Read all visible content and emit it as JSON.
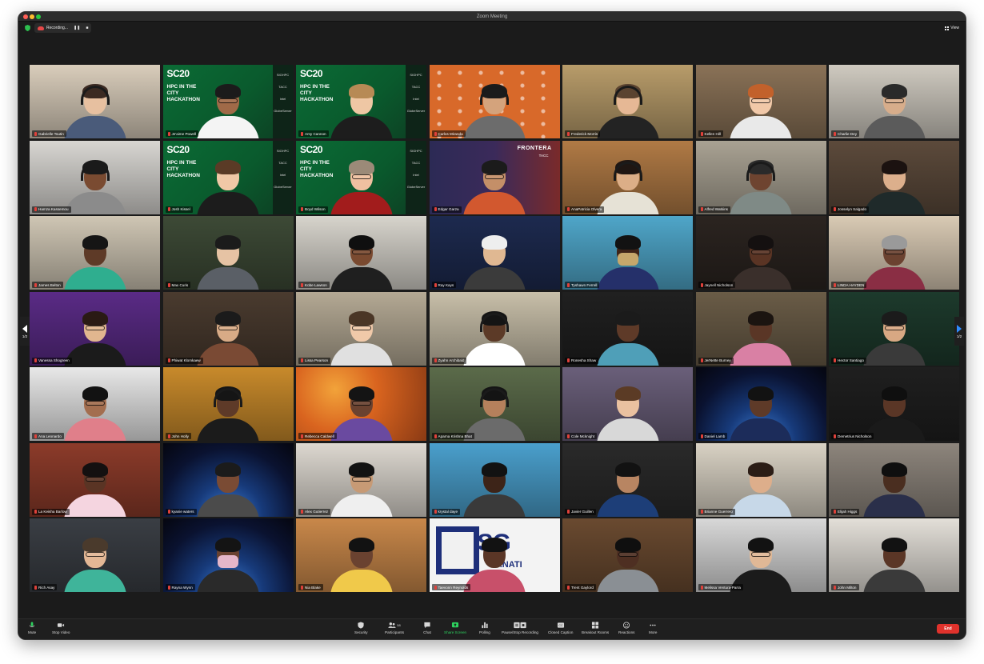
{
  "window": {
    "title": "Zoom Meeting"
  },
  "topbar": {
    "recording_label": "Recording...",
    "view_label": "View"
  },
  "pagination": {
    "left": "1/2",
    "right": "1/2"
  },
  "sc20": {
    "logo": "SC20",
    "title": "HPC IN THE CITY HACKATHON",
    "sponsors": [
      "SIGHPC",
      "TACC",
      "Intel",
      "GlobeServer"
    ]
  },
  "frontera": {
    "title": "FRONTERA",
    "tacc": "TACC"
  },
  "sgc": {
    "main": "SG",
    "sub": "ERNATI"
  },
  "participants": [
    {
      "name": "Gabrielle Toutin",
      "bg": "#d9cdbb",
      "skin": "#e7c0a0",
      "hair": "#3b2a22",
      "shirt": "#4a5b7a",
      "phones": true
    },
    {
      "name": "Je'aime Powell",
      "bg": "sc20",
      "skin": "#a06a48",
      "hair": "#1b1b1b",
      "shirt": "#f4f4f4",
      "glasses": true
    },
    {
      "name": "Amy Cannon",
      "bg": "sc20",
      "skin": "#efc7a4",
      "hair": "#b78a55",
      "shirt": "#1d1d1d"
    },
    {
      "name": "Carlos Miranda",
      "bg": "texas",
      "skin": "#d4a37c",
      "hair": "#1b1b1b",
      "shirt": "#6c6c6c",
      "phones": true
    },
    {
      "name": "Frederick Morris",
      "bg": "#b89c6a",
      "skin": "#e6b895",
      "hair": "#5a4330",
      "shirt": "#232323",
      "phones": true
    },
    {
      "name": "Kellen Hill",
      "bg": "#8a7257",
      "skin": "#f1c8a8",
      "hair": "#c2612b",
      "shirt": "#e9e9e9",
      "glasses": true
    },
    {
      "name": "Charlie Dey",
      "bg": "#cfcac0",
      "skin": "#d7ad8b",
      "hair": "#2a2a2a",
      "shirt": "#5b5b5b",
      "glasses": true
    },
    {
      "name": "Hamza Kassemou",
      "bg": "#d8d6d2",
      "skin": "#7a4b31",
      "hair": "#1a1a1a",
      "shirt": "#8b8b8b",
      "phones": true
    },
    {
      "name": "Josh Kissel",
      "bg": "sc20",
      "skin": "#f0c8a6",
      "hair": "#5a3b26",
      "shirt": "#1c1c1c"
    },
    {
      "name": "Boyd Wilson",
      "bg": "sc20",
      "skin": "#efc0a0",
      "hair": "#9b8a78",
      "shirt": "#a21c1c",
      "glasses": true
    },
    {
      "name": "Edgar Garza",
      "bg": "frontera",
      "skin": "#c48f68",
      "hair": "#1b1b1b",
      "shirt": "#d2582f",
      "glasses": true
    },
    {
      "name": "AnaPatricia Olvera",
      "bg": "#b07a45",
      "skin": "#dcae87",
      "hair": "#1f1612",
      "shirt": "#e6e2d6",
      "phones": true
    },
    {
      "name": "Alfred Watkins",
      "bg": "#a9a293",
      "skin": "#6e4430",
      "hair": "#2a2a2a",
      "shirt": "#7f8a86",
      "phones": true
    },
    {
      "name": "Josselyn Salgado",
      "bg": "#5c4a3b",
      "skin": "#dcaf8c",
      "hair": "#1b1210",
      "shirt": "#1f2a2a"
    },
    {
      "name": "James Belton",
      "bg": "#cfc6b4",
      "skin": "#5e3a27",
      "hair": "#151515",
      "shirt": "#2fae8f"
    },
    {
      "name": "Max Curis",
      "bg": "#3d4a36",
      "skin": "#e6c3a4",
      "hair": "#1b1b1b",
      "shirt": "#5a5f66"
    },
    {
      "name": "Kobe Lawson",
      "bg": "#d7d4cc",
      "skin": "#7a4a30",
      "hair": "#0f0f0f",
      "shirt": "#1f1f1f",
      "glasses": true
    },
    {
      "name": "Ray Kays",
      "bg": "#1d2a4f",
      "skin": "#e0b892",
      "hair": "#eeeeee",
      "shirt": "#3b3b3b"
    },
    {
      "name": "Tyshawn Ferrell",
      "bg": "#4fa6c9",
      "skin": "#3e2418",
      "hair": "#121212",
      "shirt": "#25306a",
      "mask": "#c6a76b"
    },
    {
      "name": "Jaynell Nicholson",
      "bg": "#2b2420",
      "skin": "#5a3424",
      "hair": "#141010",
      "shirt": "#3a2f2b",
      "glasses": true
    },
    {
      "name": "LINDA HAYDEN",
      "bg": "#d9cab4",
      "skin": "#6b4230",
      "hair": "#9a9a9a",
      "shirt": "#8a2e44",
      "glasses": true,
      "active": true
    },
    {
      "name": "Vanessa Shogreen",
      "bg": "#5a2b86",
      "skin": "#e1b68f",
      "hair": "#2a1a14",
      "shirt": "#1b1b1b",
      "glasses": true
    },
    {
      "name": "Phiwat Klomkaew",
      "bg": "#4a3b2f",
      "skin": "#d8ab86",
      "hair": "#1b1b1b",
      "shirt": "#7a4a34",
      "glasses": true
    },
    {
      "name": "Lissa Pearson",
      "bg": "#b4a994",
      "skin": "#f0c9a9",
      "hair": "#4a3626",
      "shirt": "#e0e0e0",
      "glasses": true
    },
    {
      "name": "Zyahn Archibald",
      "bg": "#c8bfa9",
      "skin": "#5c3a27",
      "hair": "#141414",
      "shirt": "#ffffff",
      "phones": true
    },
    {
      "name": "Ronesha Shaw",
      "bg": "#202020",
      "skin": "#5e3a28",
      "hair": "#1b1b1b",
      "shirt": "#4f9fb8"
    },
    {
      "name": "JerNette Burney",
      "bg": "#6a5c47",
      "skin": "#5a3626",
      "hair": "#1b1410",
      "shirt": "#d980a4"
    },
    {
      "name": "Hector Santiago",
      "bg": "#1d3a2c",
      "skin": "#d8a883",
      "hair": "#1b1b1b",
      "shirt": "#3a3a3a",
      "glasses": true
    },
    {
      "name": "Ana Leonardo",
      "bg": "#e8e8e8",
      "skin": "#a36e4f",
      "hair": "#121212",
      "shirt": "#e07f8a",
      "glasses": true
    },
    {
      "name": "John Holly",
      "bg": "#c88a2b",
      "skin": "#5e3a28",
      "hair": "#151515",
      "shirt": "#1b1b1b",
      "phones": true
    },
    {
      "name": "Rebecca Caldwell",
      "bg": "autumn",
      "skin": "#6a4230",
      "hair": "#141414",
      "shirt": "#6a4aa0",
      "glasses": true
    },
    {
      "name": "Aparna Krishna Bhat",
      "bg": "#5b6b4a",
      "skin": "#b5805c",
      "hair": "#141414",
      "shirt": "#6b6b6b",
      "phones": true
    },
    {
      "name": "Cole Mcknight",
      "bg": "#6a5f7a",
      "skin": "#eac1a0",
      "hair": "#5b3b25",
      "shirt": "#d8d8d8"
    },
    {
      "name": "Daniel Lamb",
      "bg": "space",
      "skin": "#5e3a28",
      "hair": "#121212",
      "shirt": "#1c2c5a"
    },
    {
      "name": "Demetrius Nicholson",
      "bg": "#1f1f1f",
      "skin": "#5a3626",
      "hair": "#0f0f0f",
      "shirt": "#1a1a1a"
    },
    {
      "name": "La Keisha Barlow",
      "bg": "#8c3b2a",
      "skin": "#5a3424",
      "hair": "#141010",
      "shirt": "#f5d5e0",
      "glasses": true
    },
    {
      "name": "kyanie waters",
      "bg": "space",
      "skin": "#7a4b34",
      "hair": "#1b1b1b",
      "shirt": "#4b4b4b"
    },
    {
      "name": "Alex Gutierrez",
      "bg": "#ddd8d0",
      "skin": "#c79a75",
      "hair": "#121212",
      "shirt": "#efefef",
      "glasses": true
    },
    {
      "name": "krystal daye",
      "bg": "#4a9fcc",
      "skin": "#3d2418",
      "hair": "#121212",
      "shirt": "#3a3a3a"
    },
    {
      "name": "Javier Guillen",
      "bg": "#2a2a2a",
      "skin": "#b88562",
      "hair": "#121212",
      "shirt": "#1d3e78"
    },
    {
      "name": "Brianne Guerrero",
      "bg": "#d9d2c4",
      "skin": "#ddae8b",
      "hair": "#2b1d16",
      "shirt": "#c7d8e8"
    },
    {
      "name": "Elijah Higgs",
      "bg": "#8d857c",
      "skin": "#4a2e20",
      "hair": "#0f0f0f",
      "shirt": "#2a2f4a"
    },
    {
      "name": "Rich Asay",
      "bg": "#3a3e44",
      "skin": "#e3b795",
      "hair": "#4a3a2c",
      "shirt": "#3fb49a",
      "glasses": true
    },
    {
      "name": "Rayna Wynn",
      "bg": "space",
      "skin": "#6a4230",
      "hair": "#141414",
      "shirt": "#2a2a2a",
      "mask": "#e5b6c9"
    },
    {
      "name": "Nia Blake",
      "bg": "#c9884a",
      "skin": "#6a4230",
      "hair": "#121212",
      "shirt": "#f0c94a"
    },
    {
      "name": "Taevonn Reynolds",
      "bg": "sgc",
      "skin": "#5a3626",
      "hair": "#121212",
      "shirt": "#c8506a"
    },
    {
      "name": "Trent Gaylord",
      "bg": "#6a4a30",
      "skin": "#4e2f22",
      "hair": "#0f0f0f",
      "shirt": "#8a8f94",
      "glasses": true
    },
    {
      "name": "Melissa Ventura-Parra",
      "bg": "#d8d8d8",
      "skin": "#e0b896",
      "hair": "#121212",
      "shirt": "#1b1b1b",
      "glasses": true
    },
    {
      "name": "John Milton",
      "bg": "#e3dfd8",
      "skin": "#5a3626",
      "hair": "#121212",
      "shirt": "#3a3a3a"
    }
  ],
  "toolbar": {
    "mute": "Mute",
    "stop_video": "Stop Video",
    "security": "Security",
    "participants": "Participants",
    "participants_count": "58",
    "chat": "Chat",
    "share_screen": "Share Screen",
    "polling": "Polling",
    "pause_recording": "Pause/Stop Recording",
    "closed_caption": "Closed Caption",
    "breakout_rooms": "Breakout Rooms",
    "reactions": "Reactions",
    "more": "More",
    "end": "End"
  },
  "colors": {
    "end": "#e0322c",
    "share": "#2dd15e",
    "active_outline": "#c8d84a",
    "sc20_green": "#0b6b35"
  }
}
